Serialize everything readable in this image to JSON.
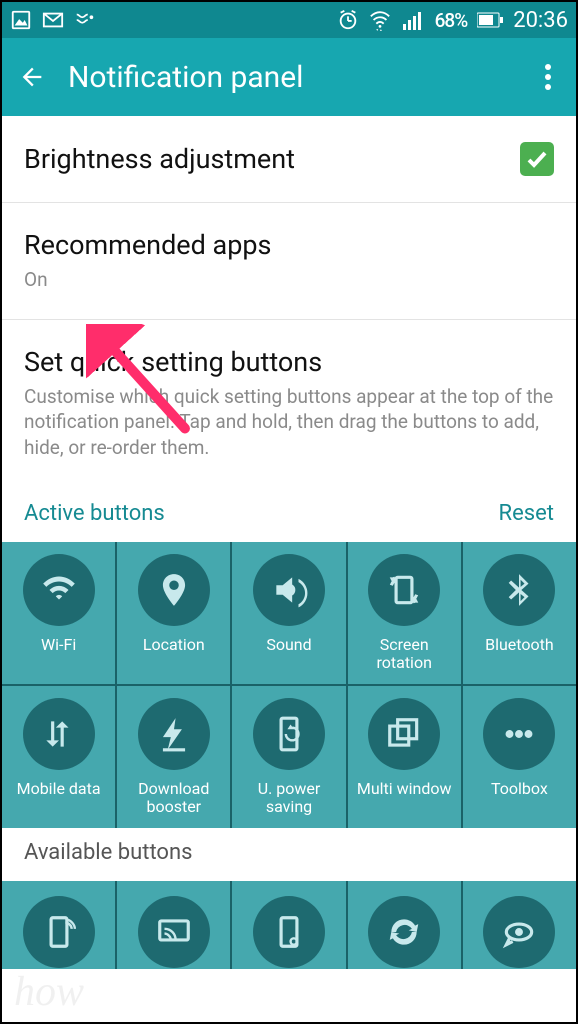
{
  "status": {
    "battery_pct": "68%",
    "time": "20:36"
  },
  "appbar": {
    "title": "Notification panel"
  },
  "items": {
    "brightness": {
      "title": "Brightness adjustment",
      "checked": true
    },
    "recommended": {
      "title": "Recommended apps",
      "sub": "On"
    },
    "quickset": {
      "title": "Set quick setting buttons",
      "sub": "Customise which quick setting buttons appear at the top of the notification panel. Tap and hold, then drag the buttons to add, hide, or re-order them."
    }
  },
  "sections": {
    "active": "Active buttons",
    "reset": "Reset",
    "available": "Available buttons"
  },
  "active_buttons": [
    {
      "id": "wifi",
      "label": "Wi-Fi",
      "icon": "wifi"
    },
    {
      "id": "location",
      "label": "Location",
      "icon": "location"
    },
    {
      "id": "sound",
      "label": "Sound",
      "icon": "sound"
    },
    {
      "id": "rotation",
      "label": "Screen rotation",
      "icon": "rotation"
    },
    {
      "id": "bluetooth",
      "label": "Bluetooth",
      "icon": "bluetooth"
    },
    {
      "id": "mdata",
      "label": "Mobile data",
      "icon": "mdata"
    },
    {
      "id": "dlboost",
      "label": "Download booster",
      "icon": "dlboost"
    },
    {
      "id": "upsaving",
      "label": "U. power saving",
      "icon": "upsaving"
    },
    {
      "id": "multiwin",
      "label": "Multi window",
      "icon": "multiwin"
    },
    {
      "id": "toolbox",
      "label": "Toolbox",
      "icon": "toolbox"
    }
  ],
  "available_buttons": [
    {
      "id": "hotspot",
      "icon": "hotspot"
    },
    {
      "id": "mirror",
      "icon": "mirror"
    },
    {
      "id": "nfc",
      "icon": "nfc"
    },
    {
      "id": "sync",
      "icon": "sync"
    },
    {
      "id": "smart",
      "icon": "smart"
    }
  ],
  "colors": {
    "primary": "#17a7b0",
    "primaryDark": "#0f8890",
    "tile": "#45a8ae",
    "circle": "#1e6a70",
    "checkbox": "#4caf50"
  }
}
